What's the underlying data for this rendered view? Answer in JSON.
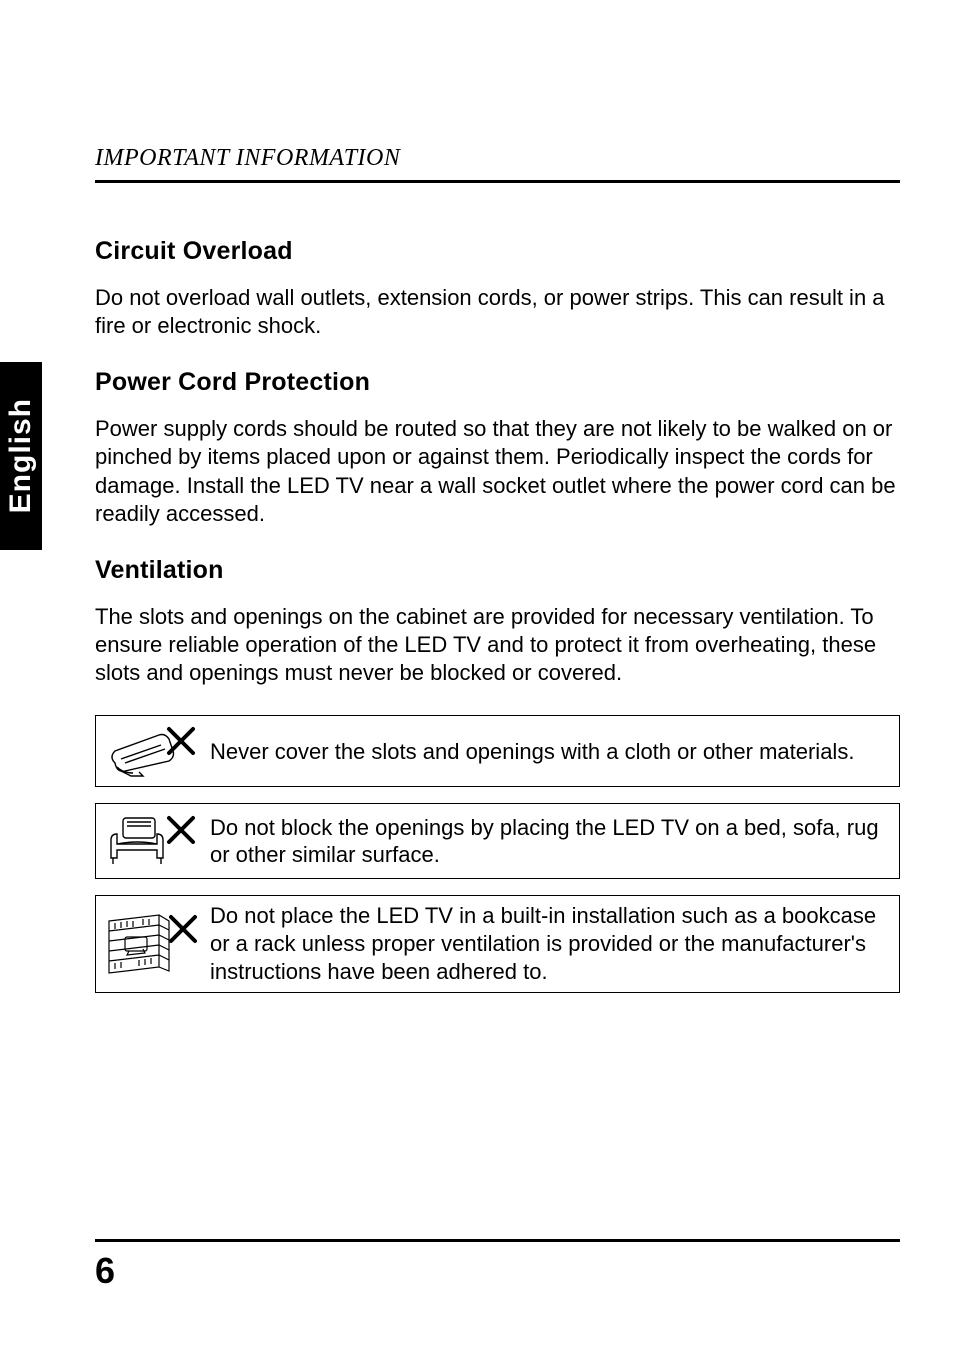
{
  "sideTab": "English",
  "headerLabel": "IMPORTANT INFORMATION",
  "sections": {
    "circuit": {
      "heading": "Circuit Overload",
      "body": "Do not overload wall outlets, extension cords, or power strips. This can result in a fire or electronic shock."
    },
    "power": {
      "heading": "Power Cord Protection",
      "body": "Power supply cords should be routed so that they are not likely to be walked on or pinched by items placed upon or against them. Periodically inspect the cords for damage. Install the LED TV near a wall socket outlet where the power cord can be readily accessed."
    },
    "ventilation": {
      "heading": "Ventilation",
      "body": "The slots and openings on the cabinet are provided for necessary ventilation. To ensure reliable operation of the LED TV and to protect it from overheating, these slots and openings must never be blocked or covered."
    }
  },
  "boxes": {
    "cloth": "Never cover the slots and openings with a cloth or other materials.",
    "bed": "Do not block the openings by placing the LED TV on a bed, sofa, rug or other similar surface.",
    "bookcase": "Do not place the LED TV in a built-in installation such as a bookcase or a rack unless proper ventilation is provided or the manufacturer's instructions have been adhered to."
  },
  "pageNumber": "6"
}
